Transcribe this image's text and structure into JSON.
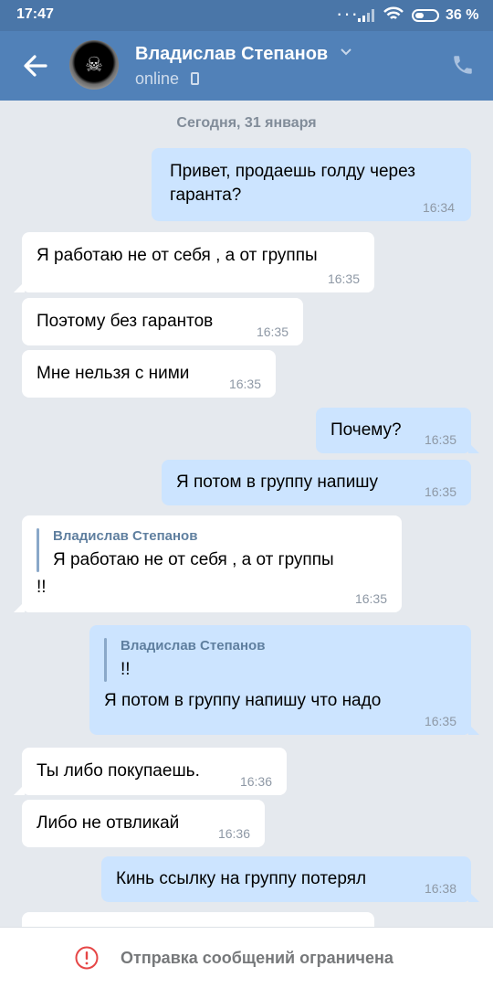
{
  "status_bar": {
    "time": "17:47",
    "battery": "36 %"
  },
  "header": {
    "name": "Владислав Степанов",
    "status": "online"
  },
  "date": "Сегодня, 31 января",
  "messages": [
    {
      "text": "Привет, продаешь голду через\nгаранта?",
      "time": "16:34",
      "out": true
    },
    {
      "text": "Я работаю не от себя , а от группы",
      "time": "16:35"
    },
    {
      "text": "Поэтому без гарантов",
      "time": "16:35"
    },
    {
      "text": "Мне нельзя с ними",
      "time": "16:35"
    },
    {
      "text": "Почему?",
      "time": "16:35",
      "out": true
    },
    {
      "text": "Я потом в группу напишу",
      "time": "16:35",
      "out": true
    },
    {
      "reply_author": "Владислав Степанов",
      "reply_text": "Я работаю не от себя , а от группы",
      "text": "!!",
      "time": "16:35"
    },
    {
      "reply_author": "Владислав Степанов",
      "reply_text": "!!",
      "text": "Я потом в группу напишу что надо",
      "time": "16:35",
      "out": true
    },
    {
      "text": "Ты либо покупаешь.",
      "time": "16:36"
    },
    {
      "text": "Либо не отвликай",
      "time": "16:36"
    },
    {
      "text": "Кинь ссылку на группу потерял",
      "time": "16:38",
      "out": true
    }
  ],
  "footer": {
    "restricted_text": "Отправка сообщений ограничена"
  },
  "icons": {
    "back": "arrow-left-icon",
    "call": "phone-icon",
    "warning": "exclamation-circle-icon"
  },
  "colors": {
    "header": "#5181b8",
    "outgoing_bubble": "#cce4ff",
    "incoming_bubble": "#ffffff",
    "warning": "#e64646"
  }
}
